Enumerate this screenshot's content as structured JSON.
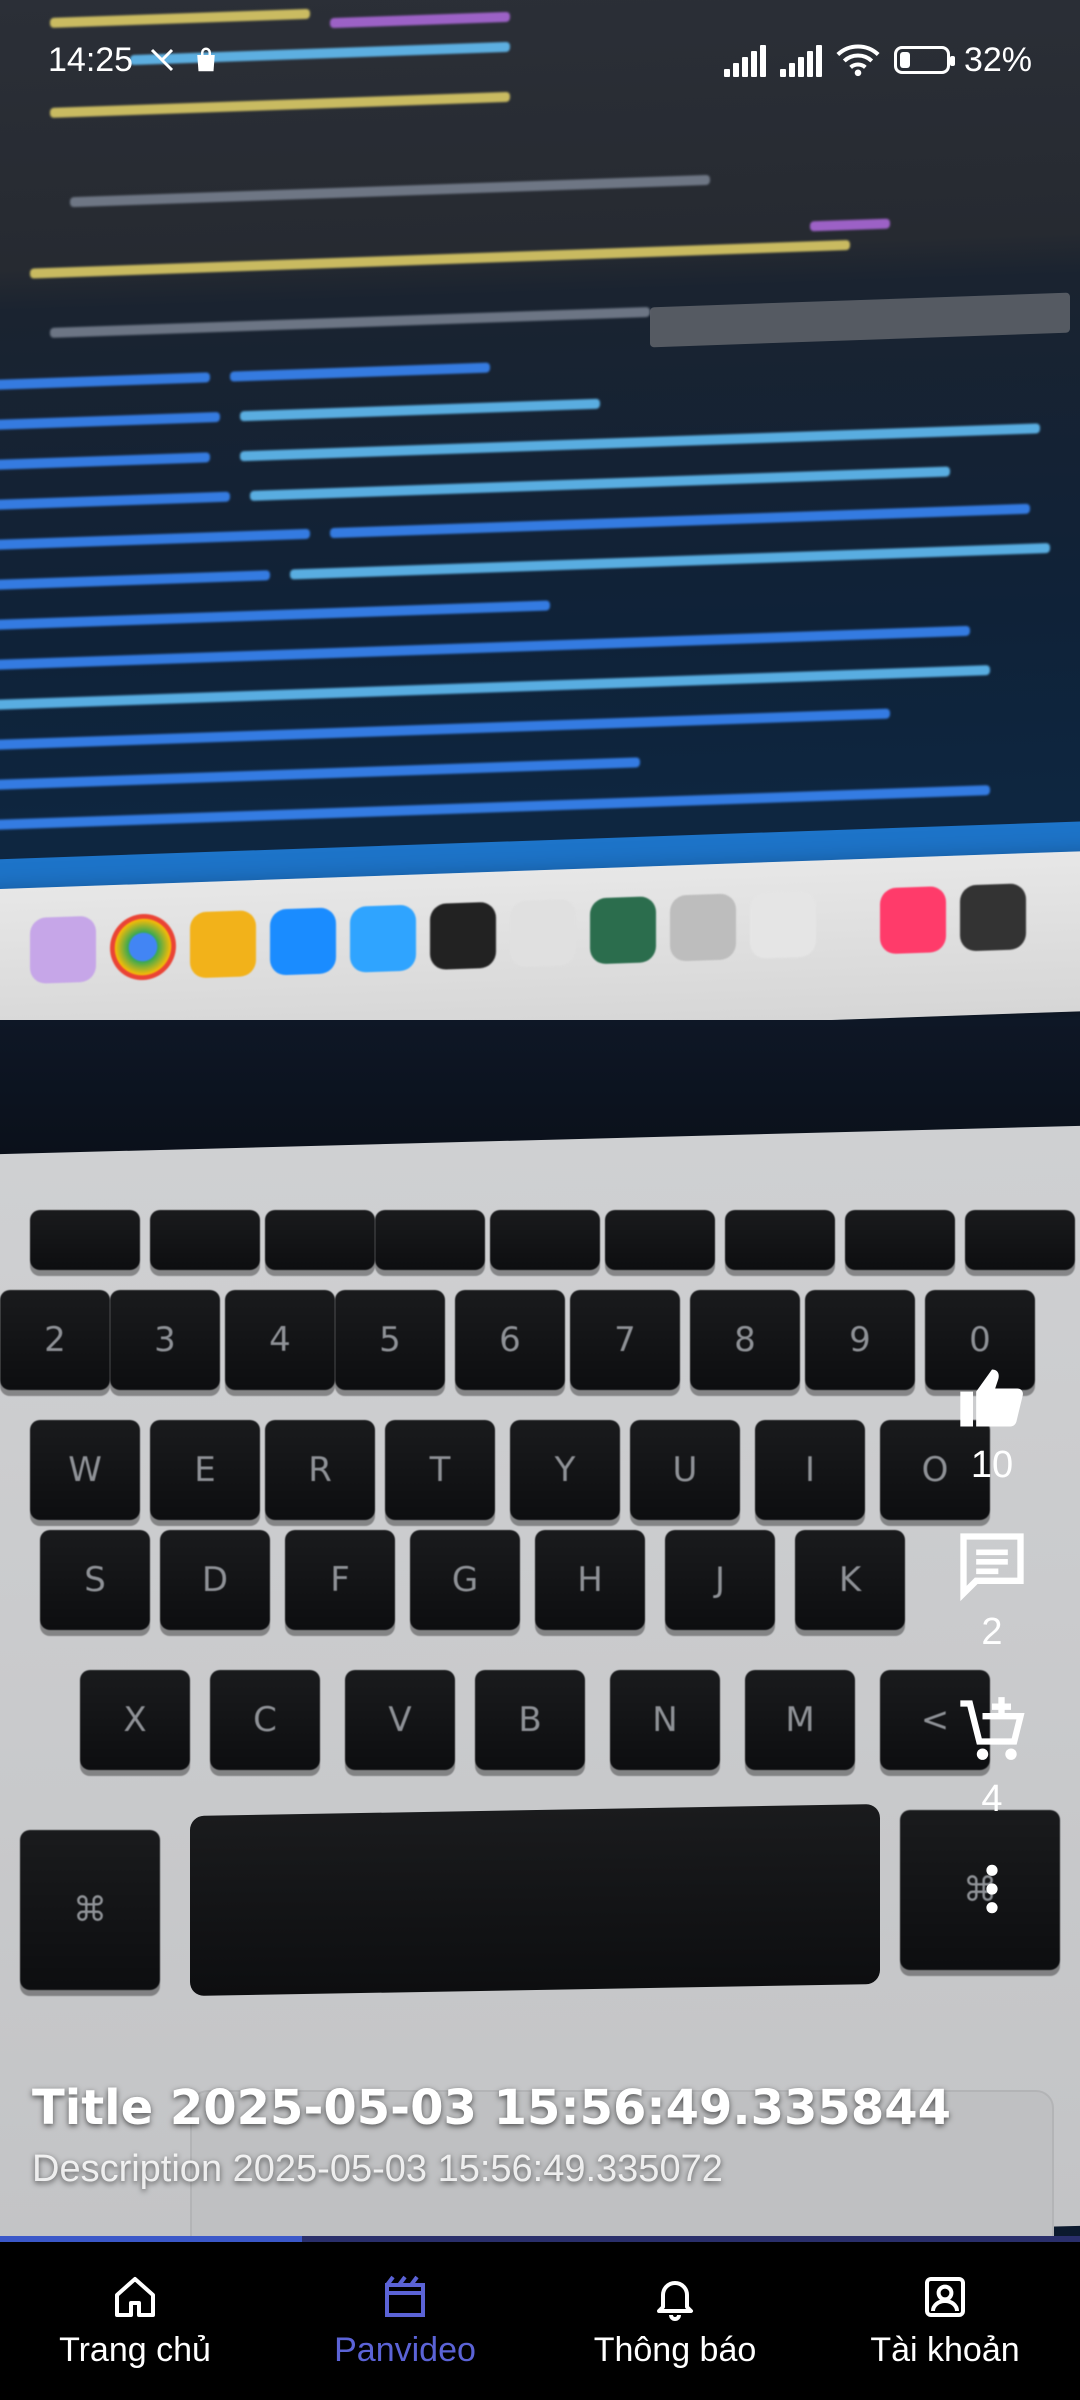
{
  "status_bar": {
    "time": "14:25",
    "battery": "32%",
    "battery_fill_percent": 32,
    "icons": [
      "notification-x-icon",
      "shopping-bag-icon",
      "signal-icon",
      "signal-icon",
      "wifi-icon",
      "battery-icon"
    ]
  },
  "video": {
    "title": "Title 2025-05-03 15:56:49.335844",
    "description": "Description 2025-05-03 15:56:49.335072",
    "progress_percent": 28
  },
  "actions": {
    "like": {
      "icon": "thumbs-up-icon",
      "count": "10"
    },
    "comment": {
      "icon": "comment-icon",
      "count": "2"
    },
    "cart": {
      "icon": "add-to-cart-icon",
      "count": "4"
    },
    "more": {
      "icon": "more-vertical-icon"
    }
  },
  "bottom_nav": {
    "items": [
      {
        "label": "Trang chủ",
        "icon": "home-icon",
        "active": false
      },
      {
        "label": "Panvideo",
        "icon": "video-clapper-icon",
        "active": true
      },
      {
        "label": "Thông báo",
        "icon": "bell-icon",
        "active": false
      },
      {
        "label": "Tài khoản",
        "icon": "account-icon",
        "active": false
      }
    ],
    "active_color": "#5b63d6"
  }
}
